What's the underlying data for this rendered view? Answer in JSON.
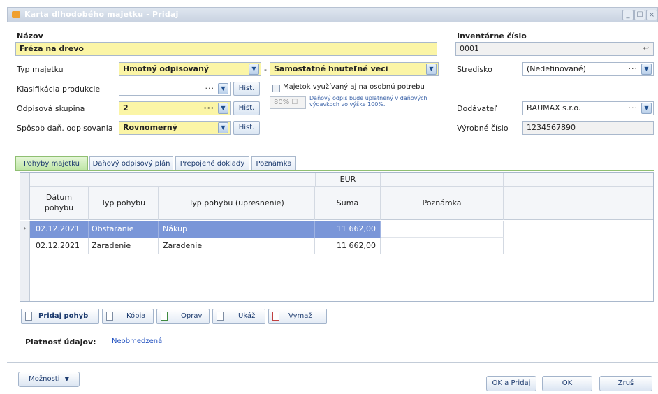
{
  "window": {
    "title": "Karta dlhodobého majetku - Pridaj",
    "buttons": [
      "_",
      "☐",
      "×"
    ]
  },
  "form": {
    "nazov_label": "Názov",
    "nazov_value": "Fréza na drevo",
    "inventarne_cislo_label": "Inventárne číslo",
    "inventarne_cislo_value": "0001",
    "typ_majetku_label": "Typ majetku",
    "typ_majetku_value": "Hmotný odpisovaný",
    "typ_separator": "-",
    "typ_majetku_sub_value": "Samostatné hnuteľné veci",
    "klasifikacia_label": "Klasifikácia produkcie",
    "klasifikacia_value": "",
    "odpisova_skupina_label": "Odpisová skupina",
    "odpisova_skupina_value": "2",
    "sposob_label": "Spôsob daň. odpisovania",
    "sposob_value": "Rovnomerný",
    "hist_label": "Hist.",
    "dots": "···",
    "dropdown_arrow": "▼",
    "majetok_checkbox_label": "Majetok využívaný aj na osobnú potrebu",
    "percent_value": "80% ☐",
    "percent_note": "Daňový odpis bude uplatnený v daňových výdavkoch vo výške 100%.",
    "stredisko_label": "Stredisko",
    "stredisko_value": "(Nedefinované)",
    "dodavatel_label": "Dodávateľ",
    "dodavatel_value": "BAUMAX s.r.o.",
    "vyrobne_cislo_label": "Výrobné číslo",
    "vyrobne_cislo_value": "1234567890",
    "inv_icon": "↩"
  },
  "tabs": [
    {
      "label": "Pohyby majetku",
      "active": true
    },
    {
      "label": "Daňový odpisový plán",
      "active": false
    },
    {
      "label": "Prepojené doklady",
      "active": false
    },
    {
      "label": "Poznámka",
      "active": false
    }
  ],
  "grid": {
    "group_header": "EUR",
    "columns": [
      "Dátum pohybu",
      "Typ pohybu",
      "Typ pohybu (upresnenie)",
      "Suma",
      "Poznámka"
    ],
    "rows": [
      {
        "datum": "02.12.2021",
        "typ": "Obstaranie",
        "upresnenie": "Nákup",
        "suma": "11 662,00",
        "poznamka": "",
        "selected": true
      },
      {
        "datum": "02.12.2021",
        "typ": "Zaradenie",
        "upresnenie": "Zaradenie",
        "suma": "11 662,00",
        "poznamka": "",
        "selected": false
      }
    ],
    "row_indicator": "›"
  },
  "toolbar": {
    "pridaj_pohyb": "Pridaj pohyb",
    "kopia": "Kópia",
    "oprav": "Oprav",
    "ukaz": "Ukáž",
    "vymaz": "Vymaž"
  },
  "platnost": {
    "label": "Platnosť údajov:",
    "value": "Neobmedzená"
  },
  "footer": {
    "moznosti": "Možnosti",
    "moznosti_arrow": "▼",
    "ok_a_pridaj": "OK a Pridaj",
    "ok": "OK",
    "zrus": "Zruš"
  },
  "colors": {
    "required_field": "#fbf5a6",
    "selected_row": "#7a96d8",
    "active_tab": "#bde5a3",
    "link": "#1f4fbf"
  }
}
